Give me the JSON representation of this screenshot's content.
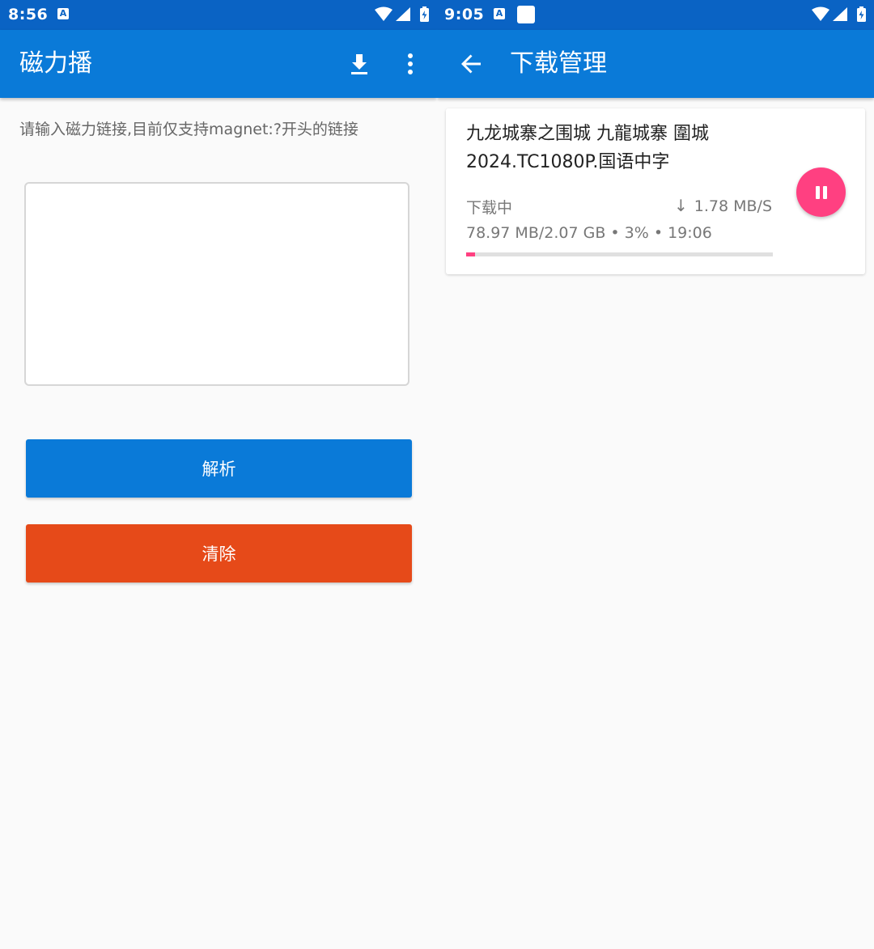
{
  "left_screen": {
    "status_bar": {
      "time": "8:56",
      "notification_icon": "A"
    },
    "app_bar": {
      "title": "磁力播",
      "download_icon": "download-icon",
      "menu_icon": "more-vert-icon"
    },
    "hint": "请输入磁力链接,目前仅支持magnet:?开头的链接",
    "magnet_input": {
      "value": "",
      "placeholder": ""
    },
    "parse_button_label": "解析",
    "clear_button_label": "清除",
    "colors": {
      "status_bar": "#0a63c4",
      "app_bar": "#0a7ad8",
      "parse_button": "#0a7ad8",
      "clear_button": "#e64a19"
    }
  },
  "right_screen": {
    "status_bar": {
      "time": "9:05",
      "notification_icon": "A"
    },
    "app_bar": {
      "title": "下载管理",
      "back_icon": "arrow-back-icon"
    },
    "download": {
      "title_line1": "九龙城寨之围城 九龍城寨 圍城",
      "title_line2": "2024.TC1080P.国语中字",
      "status": "下载中",
      "speed_arrow": "↓",
      "speed": "1.78 MB/S",
      "progress_text": "78.97 MB/2.07 GB • 3% • 19:06",
      "progress_percent": 3,
      "pause_icon": "pause-icon",
      "accent": "#ff4081"
    }
  }
}
